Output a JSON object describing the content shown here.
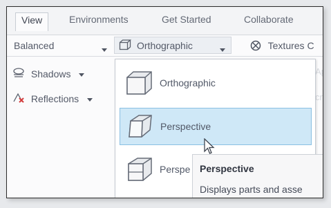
{
  "tabs": [
    {
      "label": "View"
    },
    {
      "label": "Environments"
    },
    {
      "label": "Get Started"
    },
    {
      "label": "Collaborate"
    }
  ],
  "toolbar": {
    "visual_style": "Balanced",
    "projection": "Orthographic",
    "textures": "Textures C"
  },
  "left_panel": {
    "shadows": "Shadows",
    "reflections": "Reflections"
  },
  "menu": {
    "items": [
      {
        "label": "Orthographic"
      },
      {
        "label": "Perspective"
      },
      {
        "label": "Perspe"
      }
    ]
  },
  "tooltip": {
    "title": "Perspective",
    "description": "Displays parts and asse"
  },
  "colors": {
    "selection_fill": "#cfe8f7",
    "selection_border": "#89bfe2",
    "red_accent": "#d53b3b"
  }
}
